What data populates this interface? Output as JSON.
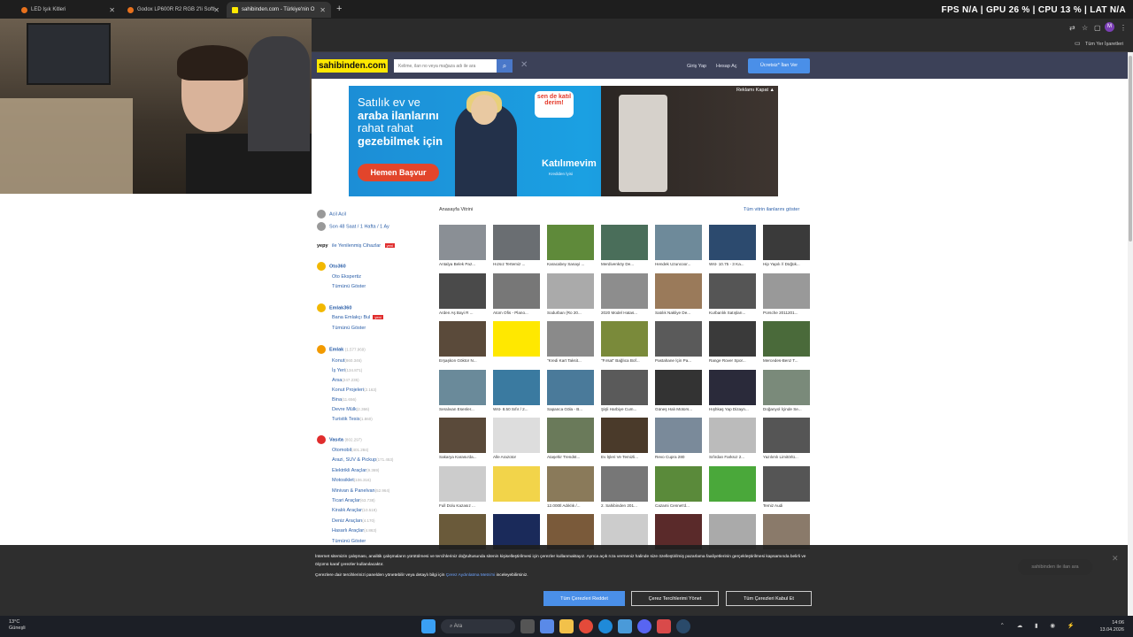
{
  "browser": {
    "tabs": [
      {
        "title": "LED Işık Kitleri",
        "active": false,
        "color": "#e8711c"
      },
      {
        "title": "Godox LP600R R2 RGB 2'li Softl",
        "active": false,
        "color": "#e8711c"
      },
      {
        "title": "sahibinden.com - Türkiye'nin O",
        "active": true,
        "color": "#ffe800"
      }
    ],
    "new_tab": "+",
    "perf_overlay": "FPS N/A | GPU 26 % | CPU 13 % | LAT N/A",
    "all_bookmarks": "Tüm Yer İşaretleri",
    "profile_initial": "M"
  },
  "header": {
    "logo": "sahibinden.com",
    "search_placeholder": "Kelime, ilan no veya mağaza adı ile ara",
    "login": "Giriş Yap",
    "register": "Hesap Aç",
    "post_ad": "Ücretsiz* İlan Ver"
  },
  "banner": {
    "line1": "Satılık ev ve",
    "line2": "araba ilanlarını",
    "line3": "rahat rahat",
    "line4": "gezebilmek için",
    "cta": "Hemen Başvur",
    "badge": "sen de katıl derim!",
    "brand": "Katılımevim",
    "brand_sub": "Krediden İyisi",
    "close": "Reklamı Kapat ▲"
  },
  "sidebar": {
    "quick": [
      {
        "label": "Acil Acil",
        "color": "#999"
      },
      {
        "label": "Son 48 Saat / 1 Hafta / 1 Ay",
        "color": "#999"
      }
    ],
    "yepy": {
      "brand": "yepy",
      "label": "ile Yenilenmiş Cihazlar",
      "badge": "yeni"
    },
    "oto360": {
      "title": "Oto360",
      "items": [
        "Oto Ekspertiz",
        "Tümünü Göster"
      ]
    },
    "emlak360": {
      "title": "Emlak360",
      "items": [
        "Bana Emlakçı Bul",
        "Tümünü Göster"
      ],
      "badge": "yeni"
    },
    "emlak": {
      "title": "Emlak",
      "count": "(1.577.969)",
      "items": [
        {
          "label": "Konut",
          "count": "(860.346)"
        },
        {
          "label": "İş Yeri",
          "count": "(134.871)"
        },
        {
          "label": "Arsa",
          "count": "(247.235)"
        },
        {
          "label": "Konut Projeleri",
          "count": "(2.163)"
        },
        {
          "label": "Bina",
          "count": "(11.656)"
        },
        {
          "label": "Devre Mülk",
          "count": "(2.366)"
        },
        {
          "label": "Turistik Tesis",
          "count": "(1.860)"
        }
      ]
    },
    "vasita": {
      "title": "Vasıta",
      "count": "(802.297)",
      "items": [
        {
          "label": "Otomobil",
          "count": "(401.284)"
        },
        {
          "label": "Arazi, SUV & Pickup",
          "count": "(171.453)"
        },
        {
          "label": "Elektrikli Araçlar",
          "count": "(9.369)"
        },
        {
          "label": "Motosiklet",
          "count": "(106.316)"
        },
        {
          "label": "Minivan & Panelvan",
          "count": "(52.964)"
        },
        {
          "label": "Ticari Araçlar",
          "count": "(63.738)"
        },
        {
          "label": "Kiralık Araçlar",
          "count": "(10.519)"
        },
        {
          "label": "Deniz Araçları",
          "count": "(4.170)"
        },
        {
          "label": "Hasarlı Araçlar",
          "count": "(4.863)"
        },
        {
          "label": "Tümünü Göster",
          "count": ""
        }
      ]
    }
  },
  "vitrin": {
    "title": "Anasayfa Vitrini",
    "show_all": "Tüm vitrin ilanlarını göster",
    "tiles": [
      {
        "cap": "Antalya Belek Paz...",
        "color": "#8a8f95"
      },
      {
        "cap": "Hızsız Tertemiz ...",
        "color": "#6a6e72"
      },
      {
        "cap": "Karacabey Sanayi ...",
        "color": "#5f8a3a"
      },
      {
        "cap": "Merdivenköy De...",
        "color": "#4a6e5a"
      },
      {
        "cap": "Hendek Uzuncoor...",
        "color": "#6e8a9a"
      },
      {
        "cap": "Wst- 10.75 - 3 Ka...",
        "color": "#2c4a6e"
      },
      {
        "cap": "Hip Yapılı // Düğük...",
        "color": "#3a3a3a"
      },
      {
        "cap": "Arden Aş Bayi R ...",
        "color": "#4a4a4a"
      },
      {
        "cap": "Atom Ofis - Plano...",
        "color": "#777"
      },
      {
        "cap": "Sodurban (Ro 20...",
        "color": "#aaa"
      },
      {
        "cap": "2020 Model Hatas...",
        "color": "#8d8d8d"
      },
      {
        "cap": "Satılık Nakliye De...",
        "color": "#9a7a5a"
      },
      {
        "cap": "Kurbanlık Satışları...",
        "color": "#555"
      },
      {
        "cap": "Porsche 2011201...",
        "color": "#999"
      },
      {
        "cap": "Erşaşkon Göktor N...",
        "color": "#5a4a3a"
      },
      {
        "cap": "",
        "color": "#ffe800"
      },
      {
        "cap": "\"Kredi Kart Taksit...",
        "color": "#8a8a8a"
      },
      {
        "cap": "\"Fırsat\" Bağlıca Bof...",
        "color": "#7a8a3a"
      },
      {
        "cap": "Pastahane İçin Pa...",
        "color": "#5a5a5a"
      },
      {
        "cap": "Range Rover Spor...",
        "color": "#3a3a3a"
      },
      {
        "cap": "Mercedes-Benz T...",
        "color": "#4a6a3a"
      },
      {
        "cap": "Seralıvan Esenler...",
        "color": "#6a8a9a"
      },
      {
        "cap": "Wst- 8.50 Sıfır / 2...",
        "color": "#3a7aa0"
      },
      {
        "cap": "Sapanca Göla - B...",
        "color": "#4a7a9a"
      },
      {
        "cap": "Şişli Harbiye Cum...",
        "color": "#5a5a5a"
      },
      {
        "cap": "Güneş Halı Motors...",
        "color": "#333"
      },
      {
        "cap": "Hışhkaş Yap Dizayn...",
        "color": "#2a2a3a"
      },
      {
        "cap": "Doğanyol İçinde Se...",
        "color": "#7a8a7a"
      },
      {
        "cap": "Sakarya Karasu'da...",
        "color": "#5a4a3a"
      },
      {
        "cap": "Alle Arazotor",
        "color": "#ddd"
      },
      {
        "cap": "Ataşehir Trendst...",
        "color": "#6a7a5a"
      },
      {
        "cap": "Ev İşleri Ve Temizli...",
        "color": "#4a3a2a"
      },
      {
        "cap": "Revo Cupra 280",
        "color": "#7a8a9a"
      },
      {
        "cap": "Sıfırdan Farksız 2...",
        "color": "#bbb"
      },
      {
        "cap": "Yazılımlı Limitörlü...",
        "color": "#555"
      },
      {
        "cap": "Full Dolu Kazasız ...",
        "color": "#ccc"
      },
      {
        "cap": "",
        "color": "#f2d44a"
      },
      {
        "cap": "12.000tl Adıklık /...",
        "color": "#8a7a5a"
      },
      {
        "cap": "2. Sahibinden 201...",
        "color": "#777"
      },
      {
        "cap": "Cazami Cennet'd...",
        "color": "#5a8a3a"
      },
      {
        "cap": "",
        "color": "#4aa83a"
      },
      {
        "cap": "Temiz Audi",
        "color": "#555"
      },
      {
        "cap": "",
        "color": "#6a5a3a"
      },
      {
        "cap": "",
        "color": "#1a2a5a"
      },
      {
        "cap": "",
        "color": "#7a5a3a"
      },
      {
        "cap": "",
        "color": "#ccc"
      },
      {
        "cap": "",
        "color": "#5a2a2a"
      },
      {
        "cap": "",
        "color": "#aaa"
      },
      {
        "cap": "",
        "color": "#8a7a6a"
      }
    ]
  },
  "cookie": {
    "text1": "İnternet sitemizin çalışması, analitik çalışmaların yürütülmesi ve tercihleriniz doğrultusunda sitenin kişiselleştirilmesi için çerezler kullanmaktayız. Ayrıca açık rıza vermeniz halinde size özelleştirilmiş pazarlama faaliyetlerinin gerçekleştirilmesi kapsamında belirli ve ölçümü karaf çerezler kullanılacaktır.",
    "text2_pre": "Çerezlere dair tercihlerinizi panelden yönetebilir veya detaylı bilgi için",
    "text2_link": "Çerez Aydınlatma Metni'ni",
    "text2_post": "inceleyebilirsiniz.",
    "reject": "Tüm Çerezleri Reddet",
    "manage": "Çerez Tercihlerimi Yönet",
    "accept": "Tüm Çerezleri Kabul Et",
    "floating": "sahibinden ile ilan ara"
  },
  "taskbar": {
    "weather_temp": "13°C",
    "weather_desc": "Güneşli",
    "search": "Ara",
    "time": "14:06",
    "date": "13.04.2026"
  }
}
